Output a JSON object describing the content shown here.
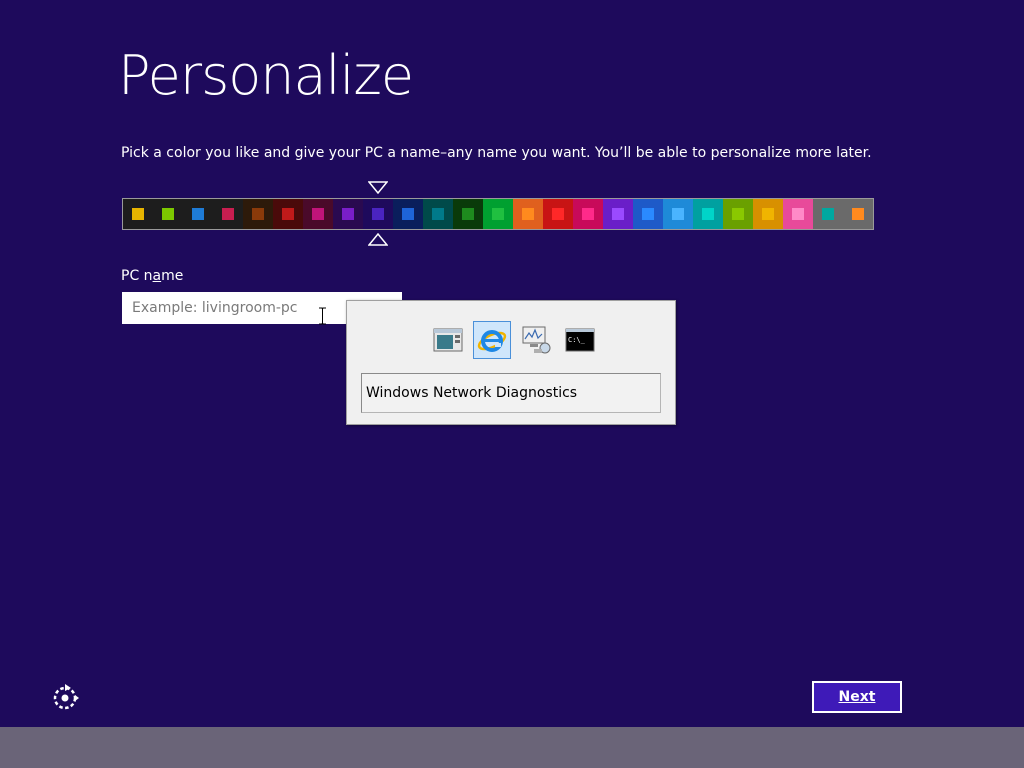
{
  "page": {
    "title": "Personalize",
    "description": "Pick a color you like and give your PC a name–any name you want. You’ll be able to personalize more later."
  },
  "color_picker": {
    "selected_index": 8,
    "swatches": [
      {
        "bg": "#1d1d1d",
        "chip": "#e6b400"
      },
      {
        "bg": "#1d1d1d",
        "chip": "#7cc800"
      },
      {
        "bg": "#1d1d1d",
        "chip": "#1e7bd6"
      },
      {
        "bg": "#1d1d1d",
        "chip": "#c81e50"
      },
      {
        "bg": "#2d1a0a",
        "chip": "#8a3a0a"
      },
      {
        "bg": "#4a0a0a",
        "chip": "#c01a1a"
      },
      {
        "bg": "#4a0a2a",
        "chip": "#c0147a"
      },
      {
        "bg": "#2a0a50",
        "chip": "#7a1ec8"
      },
      {
        "bg": "#1e0a5c",
        "chip": "#4a24c0"
      },
      {
        "bg": "#0a1e5c",
        "chip": "#1e64d8"
      },
      {
        "bg": "#004a4a",
        "chip": "#007a8a"
      },
      {
        "bg": "#0a3a0a",
        "chip": "#1e8a1e"
      },
      {
        "bg": "#00a030",
        "chip": "#20c040"
      },
      {
        "bg": "#e0601e",
        "chip": "#ff8a1e"
      },
      {
        "bg": "#c81414",
        "chip": "#ff2828"
      },
      {
        "bg": "#c80a5a",
        "chip": "#ff2a8a"
      },
      {
        "bg": "#6a1ec8",
        "chip": "#9a4aff"
      },
      {
        "bg": "#1e5ac8",
        "chip": "#2a8aff"
      },
      {
        "bg": "#1e8ad8",
        "chip": "#4ab4ff"
      },
      {
        "bg": "#00a0a0",
        "chip": "#00d4c8"
      },
      {
        "bg": "#6aa000",
        "chip": "#8ac800"
      },
      {
        "bg": "#d89000",
        "chip": "#f0b400"
      },
      {
        "bg": "#e84a9a",
        "chip": "#ff8ac8"
      },
      {
        "bg": "#6a6a6a",
        "chip": "#00a8a0"
      },
      {
        "bg": "#6a6a6a",
        "chip": "#ff8a1e"
      }
    ]
  },
  "pc_name": {
    "label": "PC name",
    "value": "",
    "placeholder": "Example: livingroom-pc"
  },
  "task_switcher": {
    "selected_title": "Windows Network Diagnostics",
    "icons": [
      {
        "name": "window-icon",
        "selected": false
      },
      {
        "name": "internet-explorer-icon",
        "selected": true
      },
      {
        "name": "network-diagnostics-icon",
        "selected": false
      },
      {
        "name": "command-prompt-icon",
        "selected": false
      }
    ],
    "command_prompt_glyph": "C:\\_"
  },
  "footer": {
    "next_label": "Next",
    "accessibility_icon": "ease-of-access-icon"
  }
}
